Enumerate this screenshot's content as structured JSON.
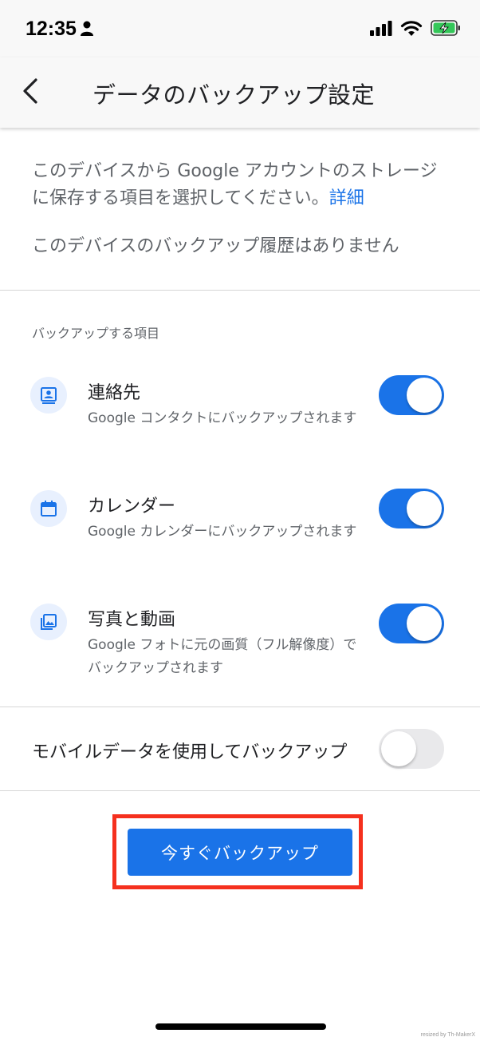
{
  "status_bar": {
    "time": "12:35",
    "icons": [
      "person-icon",
      "signal-icon",
      "wifi-icon",
      "battery-charging-icon"
    ],
    "battery_color": "#34c759"
  },
  "header": {
    "back_icon": "chevron-left-icon",
    "title": "データのバックアップ設定"
  },
  "intro": {
    "text": "このデバイスから Google アカウントのストレージに保存する項目を選択してください。",
    "link": "詳細",
    "history": "このデバイスのバックアップ履歴はありません"
  },
  "section": {
    "label": "バックアップする項目",
    "items": [
      {
        "icon": "contacts-icon",
        "title": "連絡先",
        "description": "Google コンタクトにバックアップされます",
        "enabled": true
      },
      {
        "icon": "calendar-icon",
        "title": "カレンダー",
        "description": "Google カレンダーにバックアップされます",
        "enabled": true
      },
      {
        "icon": "photos-icon",
        "title": "写真と動画",
        "description": "Google フォトに元の画質（フル解像度）でバックアップされます",
        "enabled": true
      }
    ]
  },
  "mobile_data": {
    "label": "モバイルデータを使用してバックアップ",
    "enabled": false
  },
  "backup_button": {
    "label": "今すぐバックアップ"
  },
  "watermark": "resized by Th-MakerX",
  "colors": {
    "accent": "#1a73e8",
    "highlight": "#f5301e",
    "icon_bg": "#e8f0fe"
  }
}
